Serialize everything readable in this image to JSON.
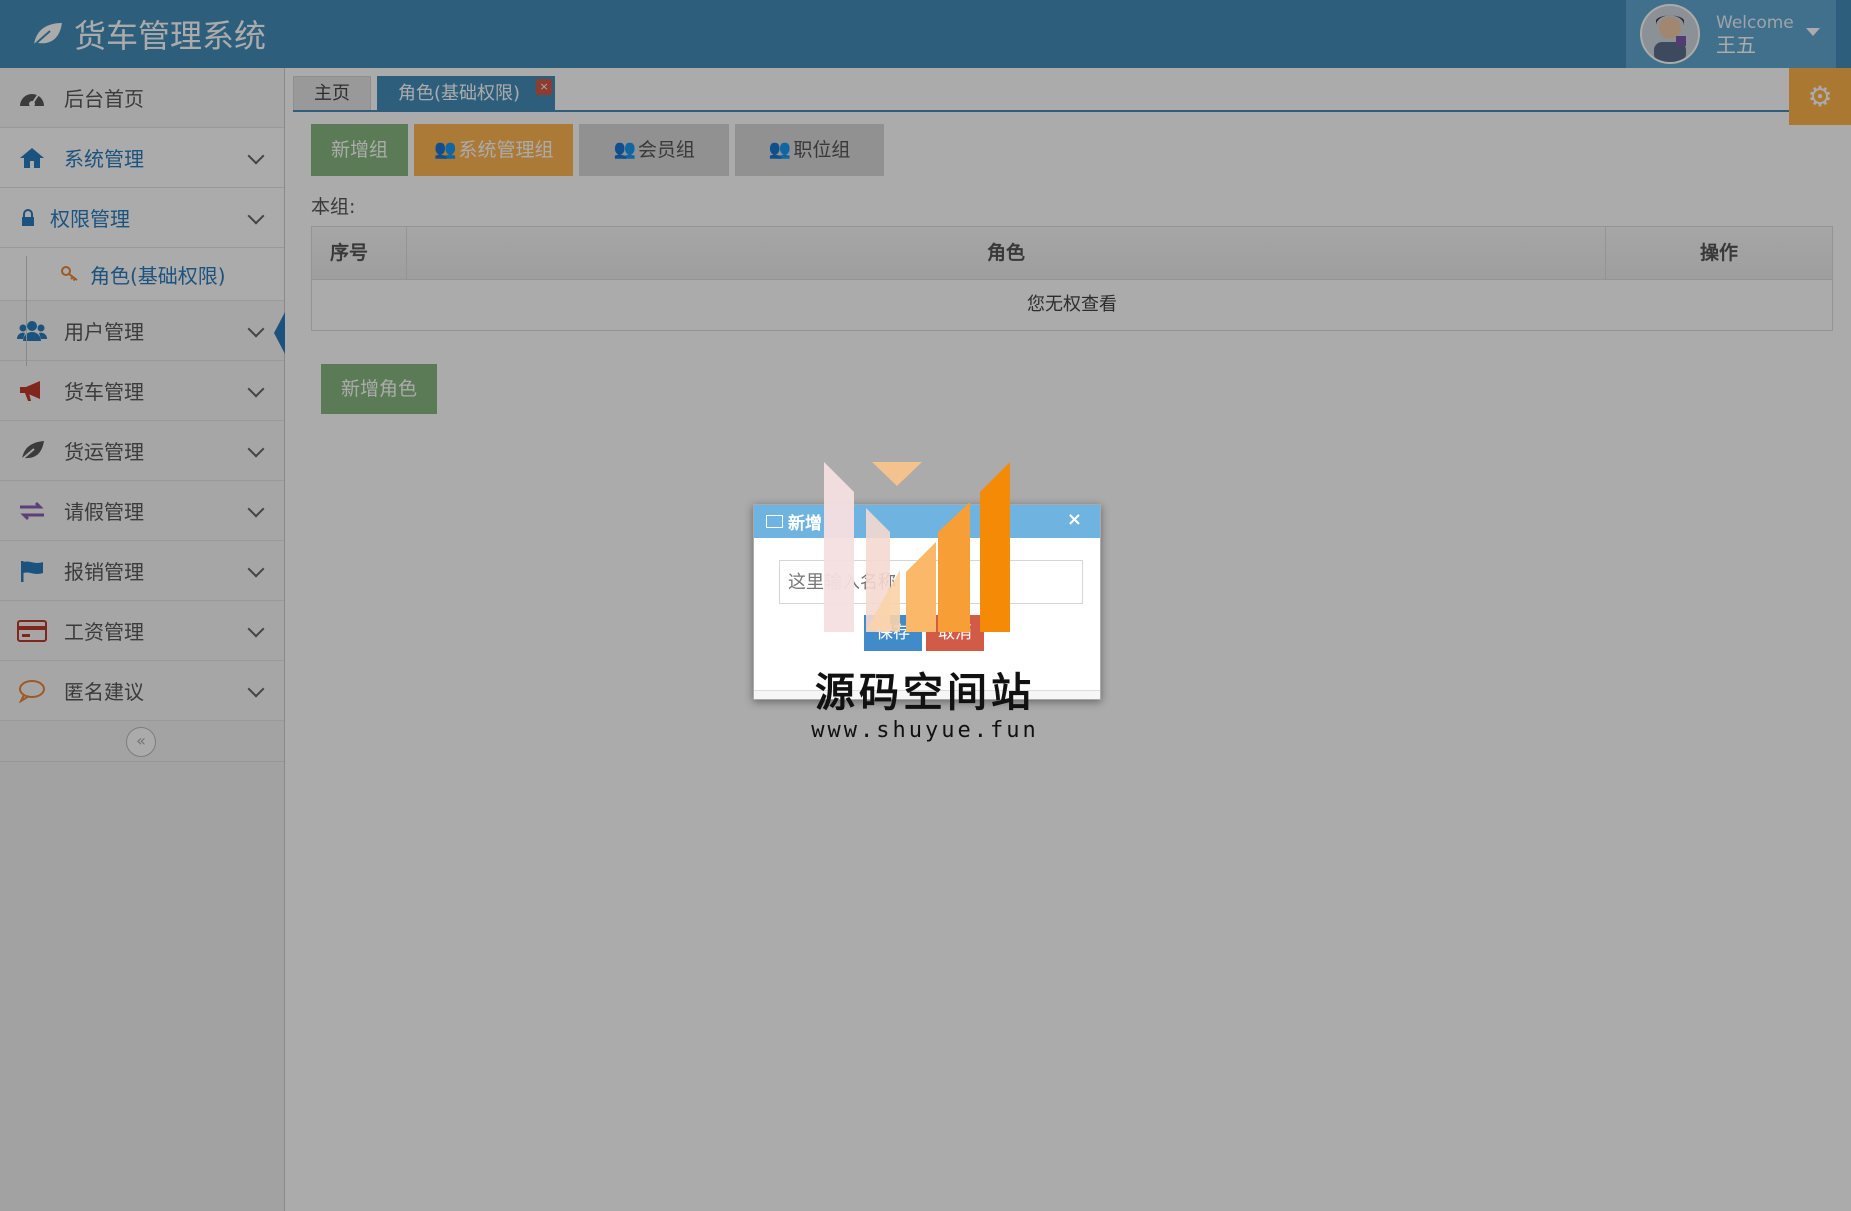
{
  "header": {
    "app_title": "货车管理系统",
    "welcome": "Welcome",
    "username": "王五",
    "brand_color": "#438eb9"
  },
  "sidebar": {
    "items": [
      {
        "label": "后台首页",
        "icon": "dashboard-icon"
      },
      {
        "label": "系统管理",
        "icon": "home-icon"
      },
      {
        "label": "权限管理",
        "icon": "lock-icon"
      },
      {
        "label": "角色(基础权限)",
        "icon": "key-icon"
      },
      {
        "label": "用户管理",
        "icon": "users-icon"
      },
      {
        "label": "货车管理",
        "icon": "bullhorn-icon"
      },
      {
        "label": "货运管理",
        "icon": "leaf-icon"
      },
      {
        "label": "请假管理",
        "icon": "exchange-icon"
      },
      {
        "label": "报销管理",
        "icon": "flag-icon"
      },
      {
        "label": "工资管理",
        "icon": "credit-card-icon"
      },
      {
        "label": "匿名建议",
        "icon": "comment-icon"
      }
    ],
    "collapse_glyph": "«"
  },
  "tabs": {
    "home": "主页",
    "current": "角色(基础权限)",
    "close_glyph": "×"
  },
  "groups": {
    "add_group": "新增组",
    "system": "系统管理组",
    "member": "会员组",
    "position": "职位组"
  },
  "main": {
    "this_group_label": "本组:",
    "columns": [
      "序号",
      "角色",
      "操作"
    ],
    "empty_text": "您无权查看",
    "add_role": "新增角色"
  },
  "dialog": {
    "title": "新增",
    "close_glyph": "×",
    "input_placeholder": "这里输入名称",
    "save": "保存",
    "cancel": "取消"
  },
  "watermark": {
    "title": "源码空间站",
    "url": "www.shuyue.fun"
  }
}
